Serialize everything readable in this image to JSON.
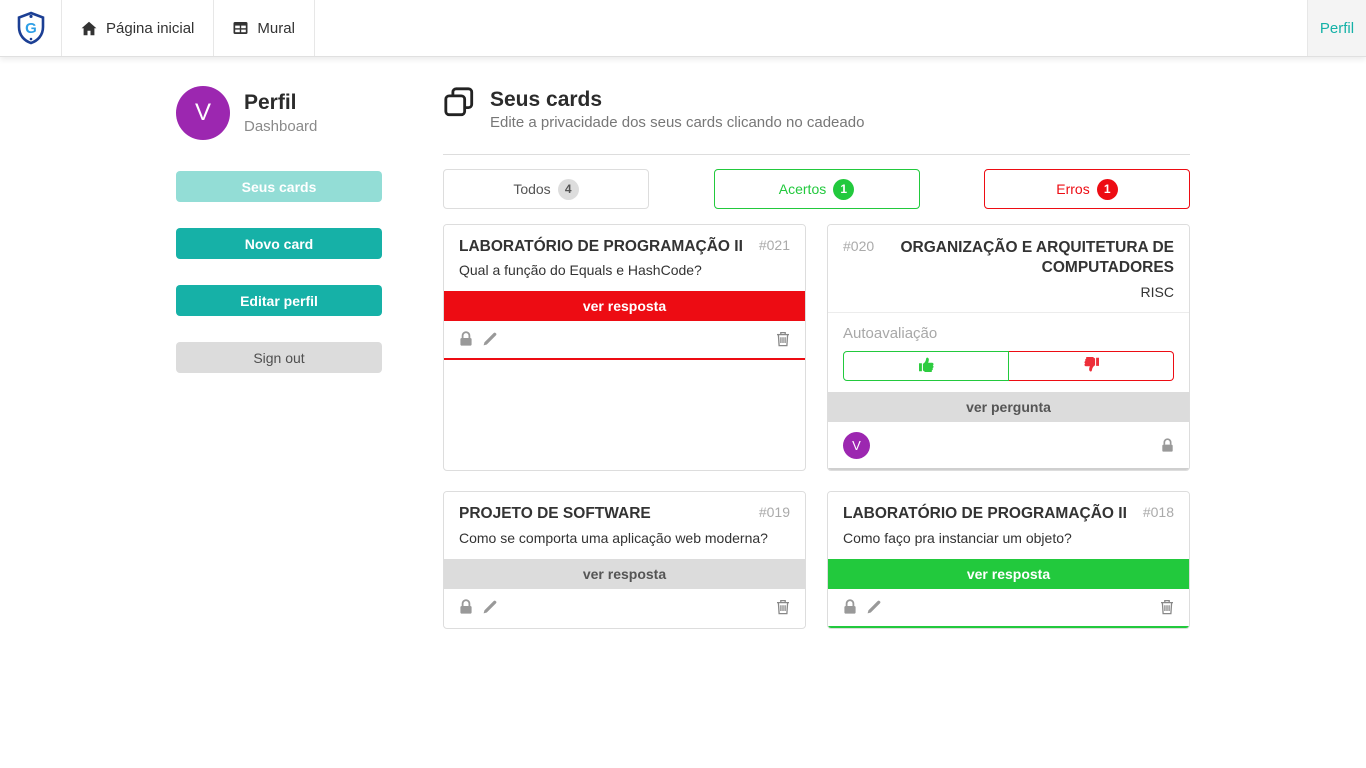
{
  "navbar": {
    "brand": {
      "icon": "shield-logo"
    },
    "items": [
      {
        "label": "Página inicial",
        "icon": "home-icon"
      },
      {
        "label": "Mural",
        "icon": "grid-icon"
      }
    ],
    "profile_link": "Perfil"
  },
  "sidebar": {
    "avatar_letter": "V",
    "title": "Perfil",
    "subtitle": "Dashboard",
    "buttons": [
      {
        "label": "Seus cards",
        "variant": "teal-light"
      },
      {
        "label": "Novo card",
        "variant": "teal"
      },
      {
        "label": "Editar perfil",
        "variant": "teal"
      },
      {
        "label": "Sign out",
        "variant": "gray"
      }
    ]
  },
  "main": {
    "header": {
      "icon": "cards-stack-icon",
      "title": "Seus cards",
      "subtitle": "Edite a privacidade dos seus cards clicando no cadeado"
    },
    "filters": [
      {
        "label": "Todos",
        "count": "4",
        "variant": "default"
      },
      {
        "label": "Acertos",
        "count": "1",
        "variant": "green"
      },
      {
        "label": "Erros",
        "count": "1",
        "variant": "red"
      }
    ],
    "cards": [
      {
        "id": "#021",
        "subject": "LABORATÓRIO DE PROGRAMAÇÃO II",
        "question": "Qual a função do Equals e HashCode?",
        "action_label": "ver resposta",
        "action_variant": "red",
        "status": "erro",
        "side": "front",
        "footer_icons": [
          "lock-icon",
          "pencil-icon",
          "trash-icon"
        ]
      },
      {
        "id": "#020",
        "subject": "ORGANIZAÇÃO E ARQUITETURA DE COMPUTADORES",
        "answer": "RISC",
        "autoeval_label": "Autoavaliação",
        "action_label": "ver pergunta",
        "side": "back",
        "avatar_letter": "V",
        "footer_icons": [
          "lock-icon"
        ],
        "eval_icons": [
          "thumbs-up-icon",
          "thumbs-down-icon"
        ]
      },
      {
        "id": "#019",
        "subject": "PROJETO DE SOFTWARE",
        "question": "Como se comporta uma aplicação web moderna?",
        "action_label": "ver resposta",
        "action_variant": "gray",
        "status": "none",
        "side": "front",
        "footer_icons": [
          "lock-icon",
          "pencil-icon",
          "trash-icon"
        ]
      },
      {
        "id": "#018",
        "subject": "LABORATÓRIO DE PROGRAMAÇÃO II",
        "question": "Como faço pra instanciar um objeto?",
        "action_label": "ver resposta",
        "action_variant": "green",
        "status": "acerto",
        "side": "front",
        "footer_icons": [
          "lock-icon",
          "pencil-icon",
          "trash-icon"
        ]
      }
    ]
  },
  "colors": {
    "teal": "#16b1a7",
    "teal_light": "#93ddd6",
    "green": "#22c93d",
    "red": "#ed0c13",
    "purple_avatar": "#9c27b0",
    "gray_button": "#dcdcdc"
  }
}
